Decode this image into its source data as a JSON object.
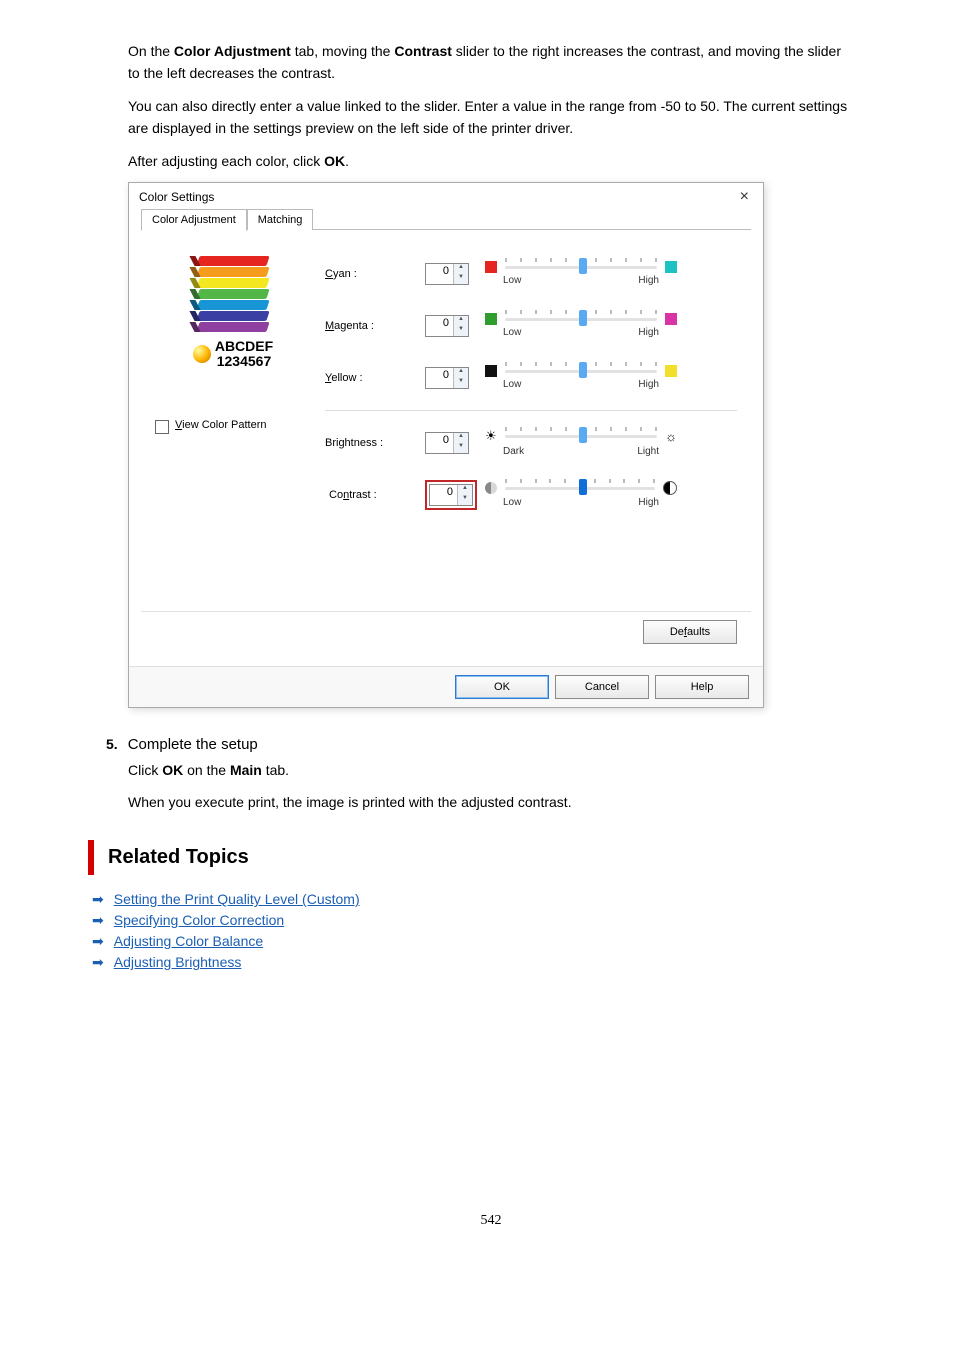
{
  "intro": {
    "p1_pre": "On the ",
    "p1_b1": "Color Adjustment",
    "p1_mid1": " tab, moving the ",
    "p1_b2": "Contrast",
    "p1_mid2": " slider to the right increases the contrast, and moving the slider to the left decreases the contrast.",
    "p2": "You can also directly enter a value linked to the slider. Enter a value in the range from -50 to 50. The current settings are displayed in the settings preview on the left side of the printer driver.",
    "p3_pre": "After adjusting each color, click ",
    "p3_b": "OK",
    "p3_post": "."
  },
  "dialog": {
    "title": "Color Settings",
    "close": "×",
    "tabs": {
      "active": "Color Adjustment",
      "other": "Matching"
    },
    "preview": {
      "abc": "ABCDEF",
      "num": "1234567"
    },
    "sliders": {
      "cyan": {
        "label_u": "C",
        "label_rest": "yan :",
        "val": "0",
        "low": "Low",
        "high": "High"
      },
      "magenta": {
        "label_u": "M",
        "label_rest": "agenta :",
        "val": "0",
        "low": "Low",
        "high": "High"
      },
      "yellow": {
        "label_u": "Y",
        "label_rest": "ellow :",
        "val": "0",
        "low": "Low",
        "high": "High"
      },
      "bright": {
        "label": "Brightness :",
        "val": "0",
        "low": "Dark",
        "high": "Light"
      },
      "contrast": {
        "label_pre": "Co",
        "label_u": "n",
        "label_post": "trast :",
        "val": "0",
        "low": "Low",
        "high": "High"
      }
    },
    "viewpattern_pre": "V",
    "viewpattern_rest": "iew Color Pattern",
    "defaults_pre": "De",
    "defaults_u": "f",
    "defaults_post": "aults",
    "ok": "OK",
    "cancel": "Cancel",
    "help": "Help"
  },
  "step5": {
    "num": "5.",
    "title": "Complete the setup",
    "b1_pre": "Click ",
    "b1_b1": "OK",
    "b1_mid": " on the ",
    "b1_b2": "Main",
    "b1_post": " tab.",
    "b2": "When you execute print, the image is printed with the adjusted contrast."
  },
  "related": {
    "heading": "Related Topics",
    "links": [
      "Setting the Print Quality Level (Custom)",
      "Specifying Color Correction",
      "Adjusting Color Balance",
      "Adjusting Brightness"
    ]
  },
  "pagenum": "542"
}
